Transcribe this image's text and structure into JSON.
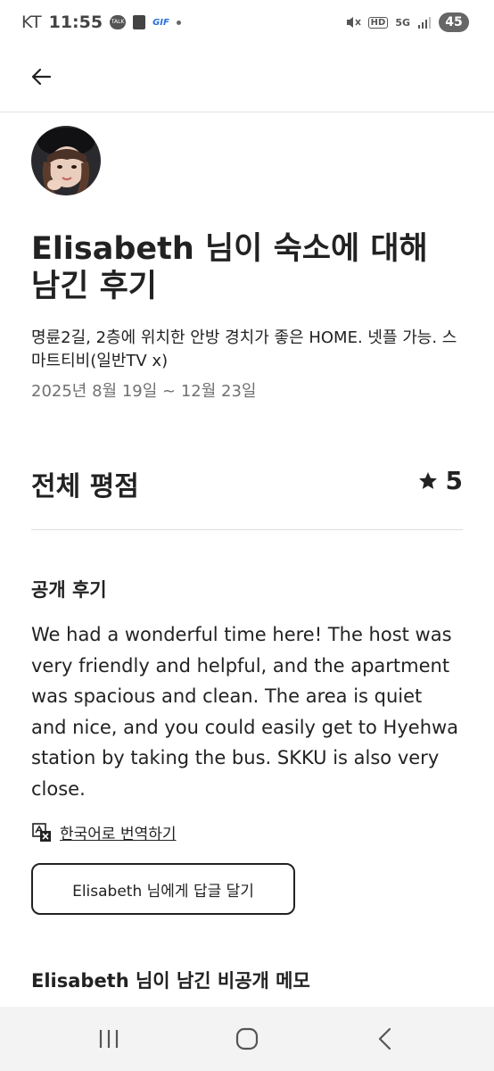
{
  "status_bar": {
    "carrier": "KT",
    "time": "11:55",
    "notification_icons": [
      "kakaotalk-icon",
      "shopping-bag-icon",
      "gif-icon",
      "dot-icon"
    ],
    "talk_badge": "TALK",
    "gif_label": "GIF",
    "system_icons": [
      "mute-icon",
      "hd-icon",
      "5g-icon",
      "signal-icon"
    ],
    "hd_label": "HD",
    "network_label": "5G",
    "battery": "45"
  },
  "header": {
    "back_icon": "arrow-left-icon"
  },
  "review": {
    "title": "Elisabeth 님이 숙소에 대해 남긴 후기",
    "listing_name": "명륜2길, 2층에 위치한 안방 경치가 좋은 HOME. 넷플 가능. 스마트티비(일반TV x)",
    "stay_dates": "2025년 8월 19일 ~ 12월 23일",
    "overall_rating_label": "전체 평점",
    "overall_rating_value": "5",
    "rating_icon": "star-icon",
    "public_review_label": "공개 후기",
    "public_review_text": "We had a wonderful time here! The host was very friendly and helpful, and the apartment was spacious and clean. The area is quiet and nice, and you could easily get to Hyehwa station by taking the bus. SKKU is also very close.",
    "translate_icon": "translate-icon",
    "translate_label": "한국어로 번역하기",
    "reply_button_label": "Elisabeth 님에게 답글 달기",
    "private_note_heading": "Elisabeth 님이 남긴 비공개 메모"
  },
  "nav_bar": {
    "icons": [
      "recent-apps-icon",
      "home-icon",
      "back-icon"
    ]
  },
  "colors": {
    "text_primary": "#222222",
    "text_secondary": "#717171",
    "divider": "#dddddd",
    "nav_background": "#f3f3f3"
  }
}
